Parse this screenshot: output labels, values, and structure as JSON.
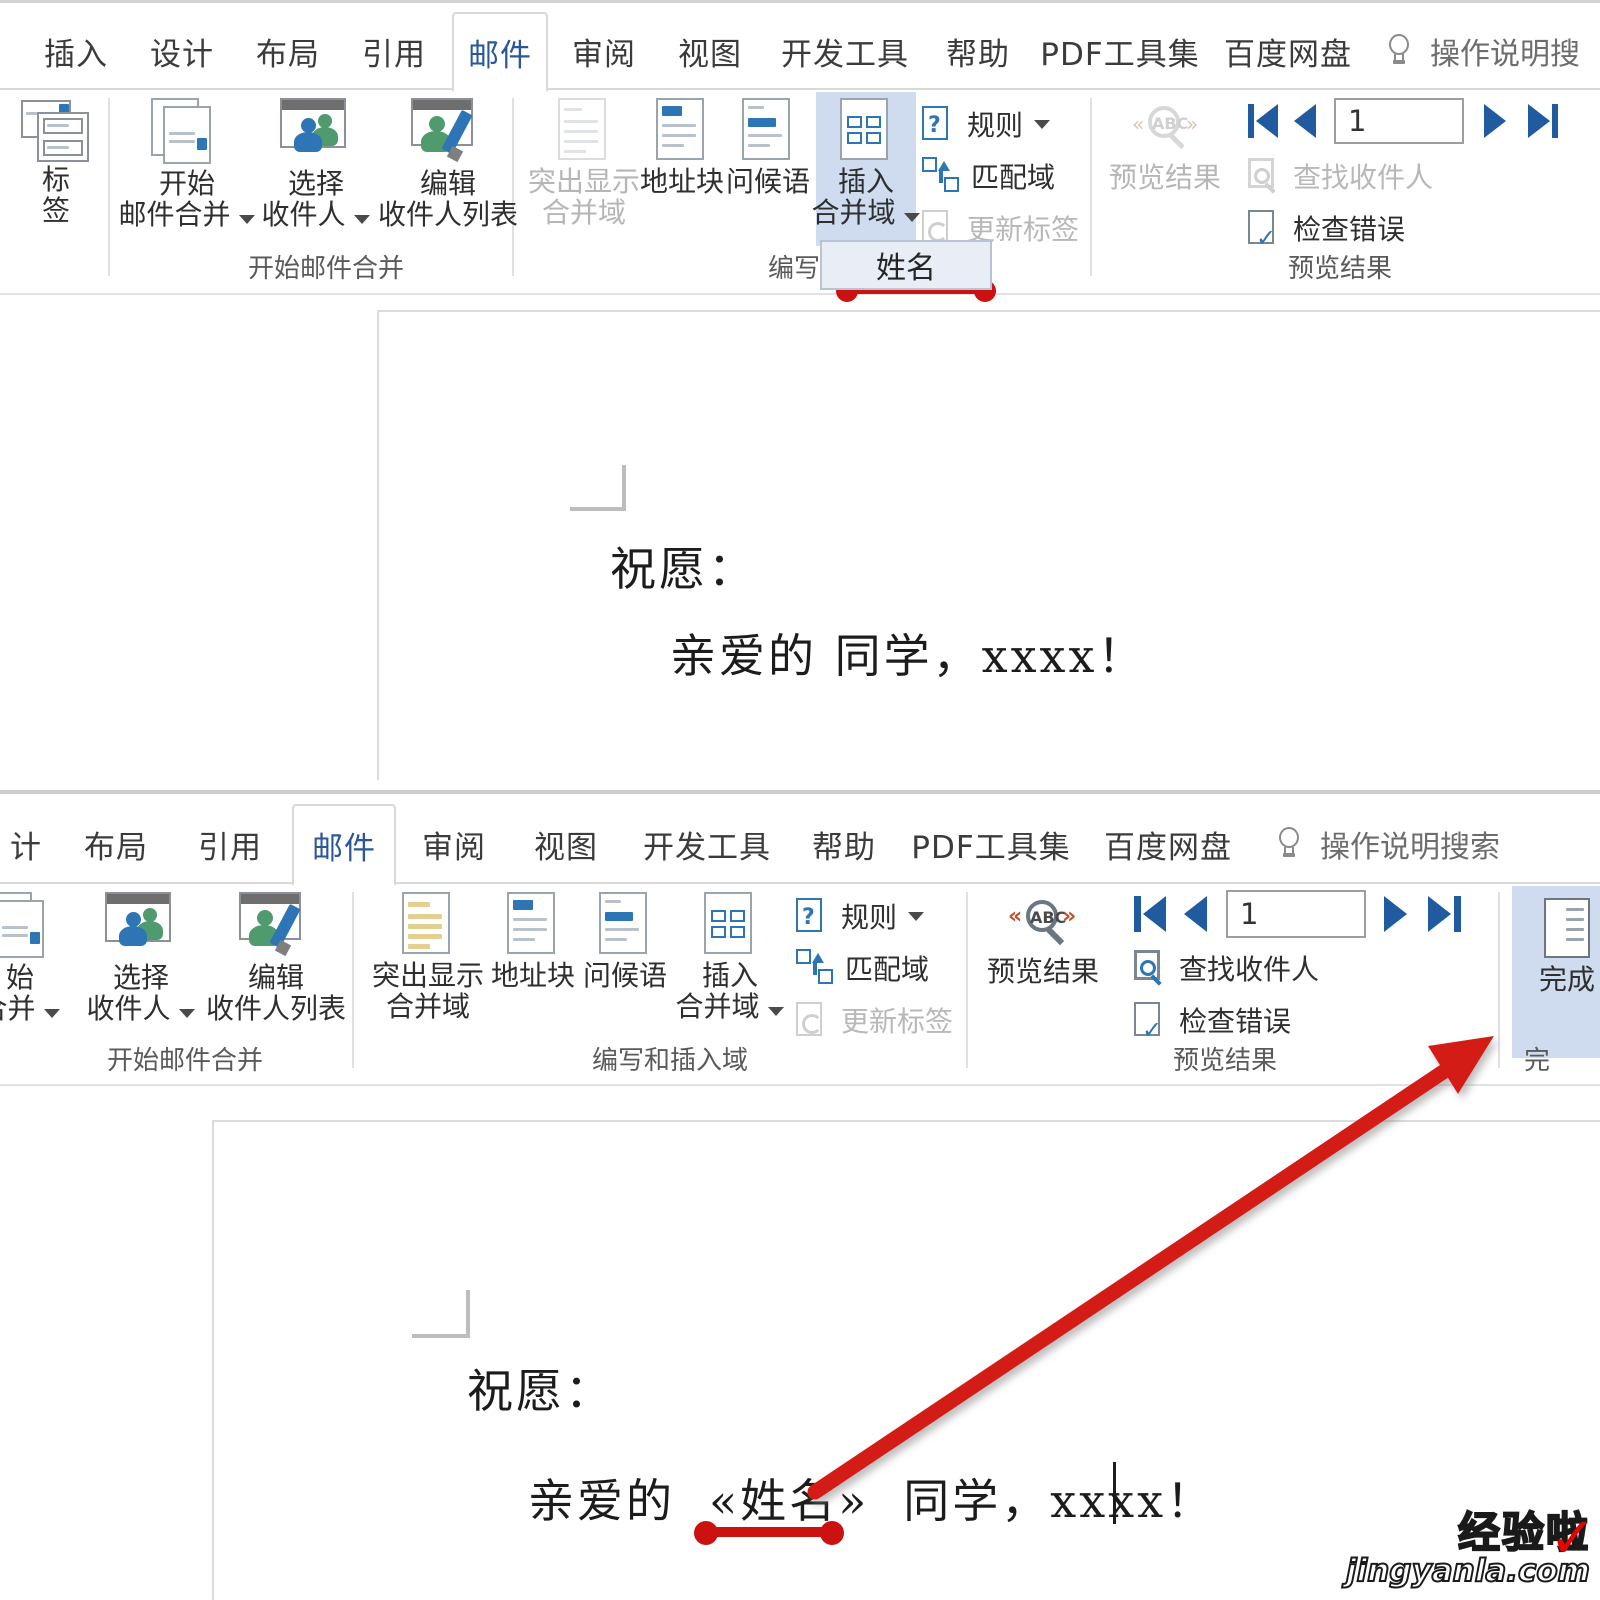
{
  "ribbon_top": {
    "tabs": [
      {
        "label": "插入",
        "active": false
      },
      {
        "label": "设计",
        "active": false
      },
      {
        "label": "布局",
        "active": false
      },
      {
        "label": "引用",
        "active": false
      },
      {
        "label": "邮件",
        "active": true
      },
      {
        "label": "审阅",
        "active": false
      },
      {
        "label": "视图",
        "active": false
      },
      {
        "label": "开发工具",
        "active": false
      },
      {
        "label": "帮助",
        "active": false
      },
      {
        "label": "PDF工具集",
        "active": false
      },
      {
        "label": "百度网盘",
        "active": false
      }
    ],
    "search": {
      "icon": "lightbulb-icon",
      "label": "操作说明搜"
    },
    "groups": [
      {
        "name": "标签组",
        "label": ""
      },
      {
        "name": "开始邮件合并",
        "label": "开始邮件合并"
      },
      {
        "name": "编写和插入域",
        "label": "编写和插"
      },
      {
        "name": "预览结果",
        "label": "预览结果"
      }
    ],
    "buttons": {
      "labels_l1": "标",
      "labels_l2": "签",
      "start_merge_l1": "开始",
      "start_merge_l2": "邮件合并",
      "select_recipients_l1": "选择",
      "select_recipients_l2": "收件人",
      "edit_recipient_list_l1": "编辑",
      "edit_recipient_list_l2": "收件人列表",
      "highlight_l1": "突出显示",
      "highlight_l2": "合并域",
      "address_block": "地址块",
      "greeting_line": "问候语",
      "insert_merge_field_l1": "插入",
      "insert_merge_field_l2": "合并域",
      "rules": "规则",
      "match_fields": "匹配域",
      "update_labels": "更新标签",
      "preview_results_l1": "预览结果",
      "find_recipient": "查找收件人",
      "check_errors": "检查错误",
      "record_number": "1"
    },
    "dropdown": {
      "open": true,
      "items": [
        "姓名"
      ]
    }
  },
  "document_top": {
    "line1": "祝愿：",
    "line2": "亲爱的        同学，xxxx！"
  },
  "ribbon_bottom": {
    "tabs": [
      {
        "label": "计",
        "active": false
      },
      {
        "label": "布局",
        "active": false
      },
      {
        "label": "引用",
        "active": false
      },
      {
        "label": "邮件",
        "active": true
      },
      {
        "label": "审阅",
        "active": false
      },
      {
        "label": "视图",
        "active": false
      },
      {
        "label": "开发工具",
        "active": false
      },
      {
        "label": "帮助",
        "active": false
      },
      {
        "label": "PDF工具集",
        "active": false
      },
      {
        "label": "百度网盘",
        "active": false
      }
    ],
    "search": {
      "icon": "lightbulb-icon",
      "label": "操作说明搜索"
    },
    "groups": [
      {
        "name": "开始邮件合并",
        "label": "开始邮件合并"
      },
      {
        "name": "编写和插入域",
        "label": "编写和插入域"
      },
      {
        "name": "预览结果",
        "label": "预览结果"
      },
      {
        "name": "完成",
        "label": "完"
      }
    ],
    "buttons": {
      "start_merge_l1": "始",
      "start_merge_l2": "合并",
      "select_recipients_l1": "选择",
      "select_recipients_l2": "收件人",
      "edit_recipient_list_l1": "编辑",
      "edit_recipient_list_l2": "收件人列表",
      "highlight_l1": "突出显示",
      "highlight_l2": "合并域",
      "address_block": "地址块",
      "greeting_line": "问候语",
      "insert_merge_field_l1": "插入",
      "insert_merge_field_l2": "合并域",
      "rules": "规则",
      "match_fields": "匹配域",
      "update_labels": "更新标签",
      "preview_results_l1": "预览结果",
      "find_recipient": "查找收件人",
      "check_errors": "检查错误",
      "record_number": "1",
      "finish_merge": "完成"
    }
  },
  "document_bottom": {
    "line1": "祝愿：",
    "line2_a": "亲爱的",
    "line2_field": "«姓名»",
    "line2_b": "同学，xxxx！"
  },
  "annotations": {
    "underline_dropdown": "red-dumbbell-underline",
    "underline_merge_field": "red-dumbbell-underline",
    "arrow_to_finish": "red-arrow"
  },
  "watermark": {
    "cn": "经验啦",
    "en": "jingyanla.com",
    "check": "✓"
  },
  "colors": {
    "accent": "#2b579a",
    "annotation_red": "#cc1111",
    "selected_bg": "#cfdcef",
    "disabled_text": "#b6b6b6",
    "icon_blue": "#2e75b6",
    "icon_green": "#4f9b6e"
  }
}
